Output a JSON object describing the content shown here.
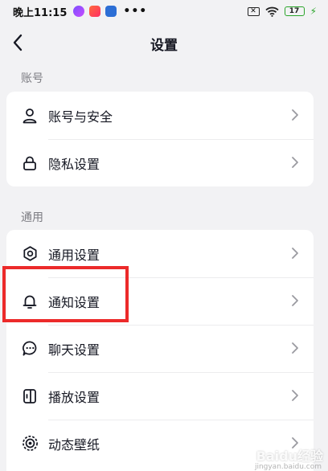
{
  "status_bar": {
    "time": "晚上11:15",
    "more": "•••",
    "sim": "✕",
    "battery": "17"
  },
  "nav": {
    "title": "设置"
  },
  "sections": {
    "account": {
      "label": "账号",
      "items": [
        {
          "label": "账号与安全",
          "icon": "person-icon"
        },
        {
          "label": "隐私设置",
          "icon": "lock-icon"
        }
      ]
    },
    "general": {
      "label": "通用",
      "items": [
        {
          "label": "通用设置",
          "icon": "gear-icon"
        },
        {
          "label": "通知设置",
          "icon": "bell-icon"
        },
        {
          "label": "聊天设置",
          "icon": "chat-bubble-icon"
        },
        {
          "label": "播放设置",
          "icon": "play-settings-icon"
        },
        {
          "label": "动态壁纸",
          "icon": "live-wallpaper-icon"
        }
      ]
    }
  },
  "watermark": {
    "text": "Baidu经验",
    "sub": "jingyan.baidu.com"
  },
  "colors": {
    "background": "#f2f2f4",
    "card": "#ffffff",
    "highlight": "#ec2a2a"
  }
}
